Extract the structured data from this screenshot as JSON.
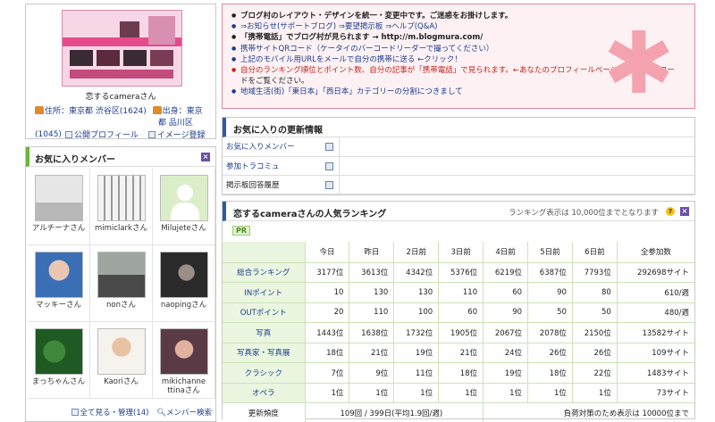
{
  "profile": {
    "name": "恋するcameraさん",
    "address_line1": "住所：東京都 渋谷区(1624)",
    "address_line2": "出身：東京",
    "address_line3": "都 品川区(1045)",
    "link_public": "公開プロフィール",
    "link_image": "イメージ登録"
  },
  "favorites": {
    "title": "お気に入りメンバー",
    "members": [
      {
        "name": "アルチーナさん",
        "thumb": "silhouette-dancers"
      },
      {
        "name": "mimiclarkさん",
        "thumb": "sketch-figures"
      },
      {
        "name": "Milujeteさん",
        "thumb": "default-avatar"
      },
      {
        "name": "マッキーさん",
        "thumb": "portrait-woman"
      },
      {
        "name": "nonさん",
        "thumb": "motorcycle"
      },
      {
        "name": "naopingさん",
        "thumb": "dark-portrait"
      },
      {
        "name": "まっちゃんさん",
        "thumb": "clover-leaves"
      },
      {
        "name": "Kaoriさん",
        "thumb": "smiling-woman"
      },
      {
        "name": "mikichanne ttinaさん",
        "thumb": "woman-portrait"
      }
    ],
    "footer_all": "全て見る・管理(14)",
    "footer_search": "メンバー検索"
  },
  "notice": {
    "items": [
      {
        "text": "ブログ村のレイアウト・デザインを統一・変更中です。ご迷惑をお掛けします。",
        "style": "b"
      },
      {
        "text": "⇒お知らせ(サポートブログ) ⇒要望掲示板 ⇒ヘルプ(Q&A)",
        "style": "link"
      },
      {
        "text": "「携帯電話」でブログ村が見られます → http://m.blogmura.com/",
        "style": "b"
      },
      {
        "text": "携帯サイトQRコード（ケータイのバーコードリーダーで撮ってください）",
        "style": "link"
      },
      {
        "text": "上記のモバイル用URLをメールで自分の携帯に送る ←クリック！",
        "style": "link"
      },
      {
        "text": "自分のランキング順位とポイント数、自分の記事が「携帯電話」で見られます。←あなたのプロフィールページ内左側のQRコー",
        "style": "red"
      },
      {
        "text": "ドをご覧ください。",
        "style": "plain"
      },
      {
        "text": "地域生活(街)「東日本」「西日本」カテゴリーの分割につきまして",
        "style": "link"
      }
    ]
  },
  "updates": {
    "title": "お気に入りの更新情報",
    "rows": [
      "お気に入りメンバー",
      "参加トラコミュ",
      "掲示板回答履歴"
    ]
  },
  "ranking": {
    "title": "恋するcameraさんの人気ランキング",
    "note": "ランキング表示は 10,000位までとなります",
    "pr": "PR",
    "columns": [
      "今日",
      "昨日",
      "2日前",
      "3日前",
      "4日前",
      "5日前",
      "6日前",
      "全参加数"
    ],
    "rows": [
      {
        "label": "総合ランキング",
        "values": [
          "3177位",
          "3613位",
          "4342位",
          "5376位",
          "6219位",
          "6387位",
          "7793位",
          "292698サイト"
        ]
      },
      {
        "label": "INポイント",
        "values": [
          "10",
          "130",
          "130",
          "110",
          "60",
          "90",
          "80",
          "610/週"
        ]
      },
      {
        "label": "OUTポイント",
        "values": [
          "20",
          "110",
          "100",
          "60",
          "90",
          "50",
          "50",
          "480/週"
        ]
      },
      {
        "label": "写真",
        "values": [
          "1443位",
          "1638位",
          "1732位",
          "1905位",
          "2067位",
          "2078位",
          "2150位",
          "13582サイト"
        ]
      },
      {
        "label": "写真家・写真展",
        "values": [
          "18位",
          "21位",
          "19位",
          "21位",
          "24位",
          "26位",
          "26位",
          "109サイト"
        ]
      },
      {
        "label": "クラシック",
        "values": [
          "7位",
          "9位",
          "11位",
          "18位",
          "19位",
          "18位",
          "22位",
          "1483サイト"
        ]
      },
      {
        "label": "オペラ",
        "values": [
          "1位",
          "1位",
          "1位",
          "1位",
          "1位",
          "1位",
          "1位",
          "73サイト"
        ]
      }
    ],
    "freq_label": "更新頻度",
    "freq_value": "109回 / 399日(平均1.9回/週)",
    "freq_note": "負荷対策のため表示は 10000位まで"
  }
}
